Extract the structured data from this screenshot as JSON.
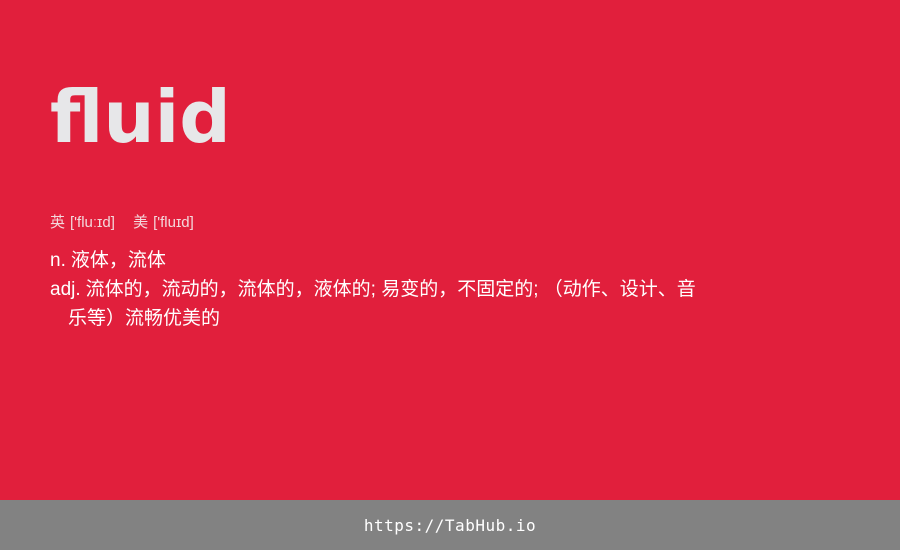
{
  "word": "fluid",
  "phonetics": [
    {
      "label": "英",
      "ipa": "['fluːɪd]"
    },
    {
      "label": "美",
      "ipa": "['fluɪd]"
    }
  ],
  "definitions": [
    {
      "pos": "n.",
      "text": "液体，流体",
      "continuation": ""
    },
    {
      "pos": "adj.",
      "text": "流体的，流动的，流体的，液体的; 易变的，不固定的; （动作、设计、音",
      "continuation": "乐等）流畅优美的"
    }
  ],
  "footer": {
    "link_text": "https://TabHub.io"
  },
  "colors": {
    "background": "#e11f3c",
    "word": "#e7e7e9",
    "footer_bar": "#828282"
  }
}
